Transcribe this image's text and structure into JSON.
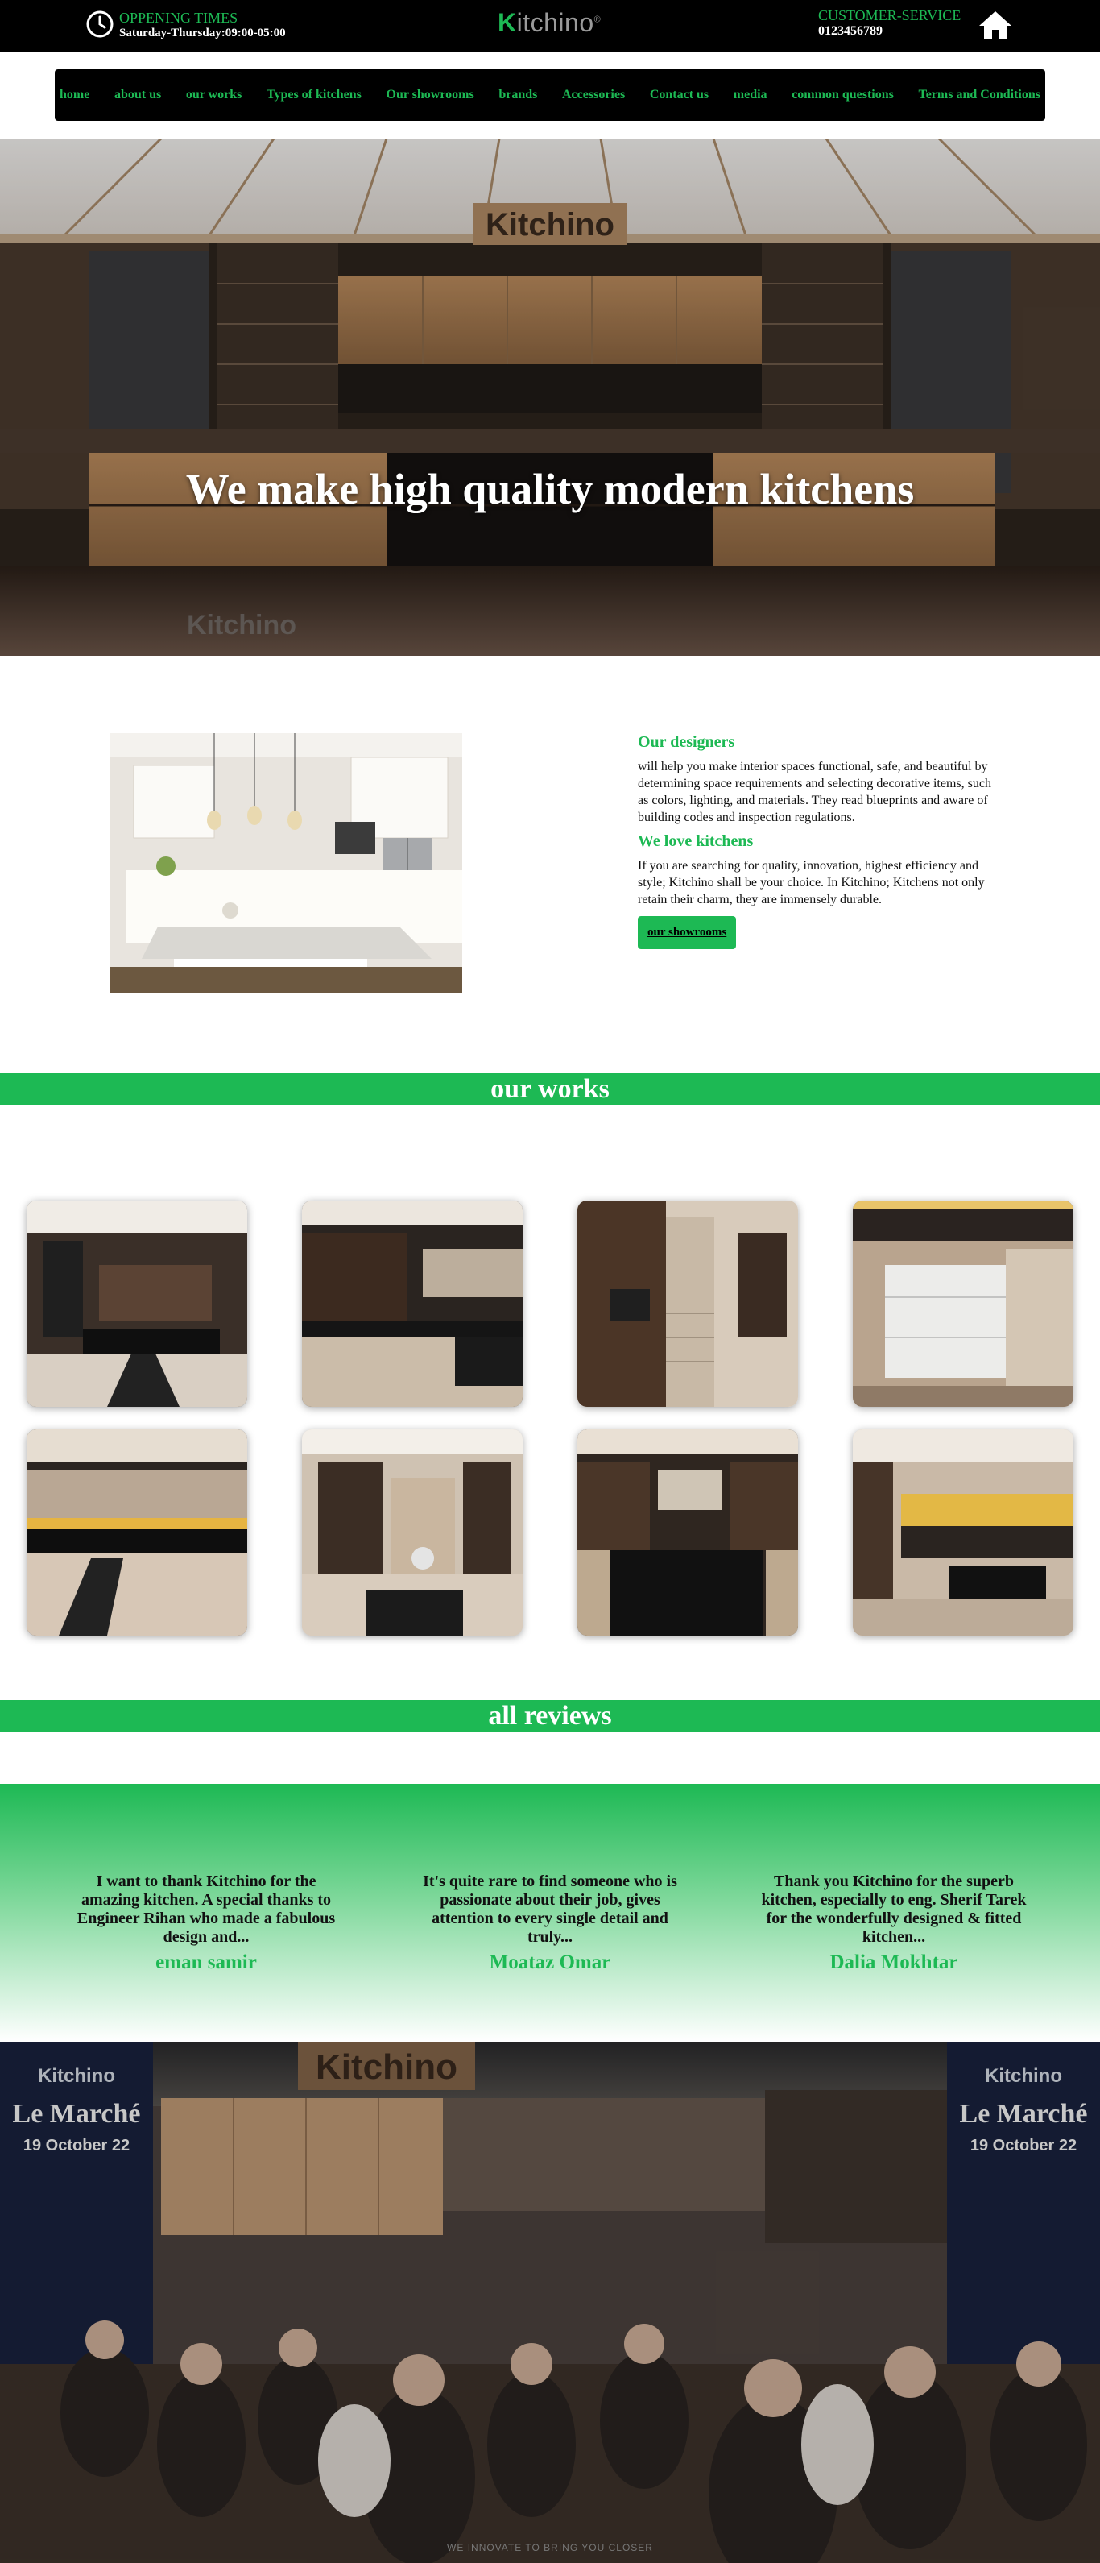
{
  "header": {
    "opening_label": "OPPENING TIMES",
    "opening_hours": "Saturday-Thursday:09:00-05:00",
    "logo_text": "Kitchino",
    "customer_service_label": "CUSTOMER-SERVICE",
    "phone": "0123456789"
  },
  "nav": {
    "items": [
      {
        "label": "home"
      },
      {
        "label": "about us"
      },
      {
        "label": "our works"
      },
      {
        "label": "Types of kitchens"
      },
      {
        "label": "Our showrooms"
      },
      {
        "label": "brands"
      },
      {
        "label": "Accessories"
      },
      {
        "label": "Contact us"
      },
      {
        "label": "media"
      },
      {
        "label": "common questions"
      },
      {
        "label": "Terms and Conditions"
      }
    ]
  },
  "hero": {
    "headline": "We make high quality modern kitchens",
    "sign_text": "Kitchino",
    "watermark": "Kitchino"
  },
  "about": {
    "designers_title": "Our designers",
    "designers_text": "will help you make interior spaces functional, safe, and beautiful by determining space requirements and selecting decorative items, such as colors, lighting, and materials. They read blueprints and aware of building codes and inspection regulations.",
    "love_title": "We love kitchens",
    "love_text": "If you are searching for quality, innovation, highest efficiency and style; Kitchino shall be your choice. In Kitchino; Kitchens not only retain their charm, they are immensely durable.",
    "button_label": "our showrooms"
  },
  "works": {
    "title": "our works",
    "items": [
      {
        "alt": "kitchen work 1"
      },
      {
        "alt": "kitchen work 2"
      },
      {
        "alt": "kitchen work 3"
      },
      {
        "alt": "kitchen work 4"
      },
      {
        "alt": "kitchen work 5"
      },
      {
        "alt": "kitchen work 6"
      },
      {
        "alt": "kitchen work 7"
      },
      {
        "alt": "kitchen work 8"
      }
    ]
  },
  "reviews": {
    "title": "all reviews",
    "items": [
      {
        "text": "I want to thank Kitchino for the amazing kitchen. A special thanks to Engineer Rihan who made a fabulous design and...",
        "name": "eman samir"
      },
      {
        "text": "It's quite rare to find someone who is passionate about their job, gives attention to every single detail and truly...",
        "name": "Moataz Omar"
      },
      {
        "text": "Thank you Kitchino for the superb kitchen, especially to eng. Sherif Tarek for the wonderfully designed & fitted kitchen...",
        "name": "Dalia Mokhtar"
      }
    ]
  },
  "showroom": {
    "sign_text": "Kitchino",
    "event_brand": "Kitchino",
    "event_name": "Le Marché",
    "event_date": "19 October 22",
    "footer_tagline": "WE INNOVATE TO BRING YOU CLOSER"
  },
  "colors": {
    "brand_green": "#1db954",
    "bar_black": "#000000"
  }
}
